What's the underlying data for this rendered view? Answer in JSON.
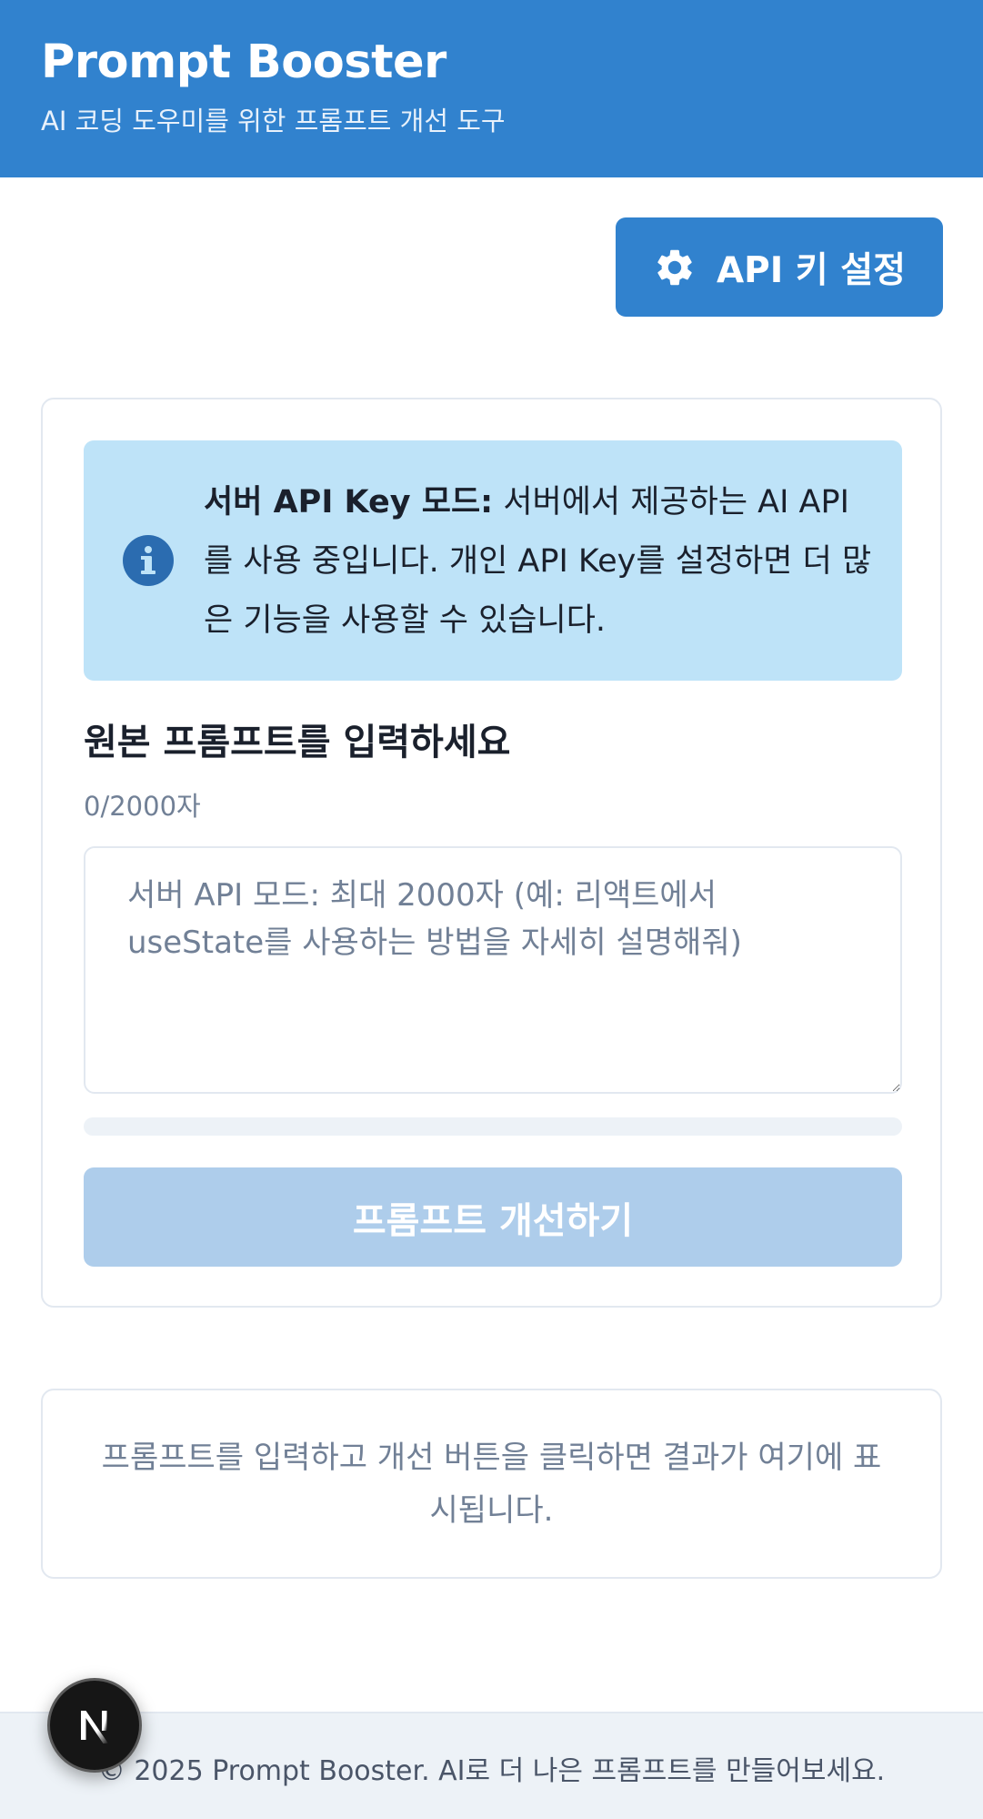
{
  "header": {
    "title": "Prompt Booster",
    "subtitle": "AI 코딩 도우미를 위한 프롬프트 개선 도구"
  },
  "toolbar": {
    "api_settings_label": "API 키 설정",
    "api_settings_icon": "gear-icon"
  },
  "info": {
    "icon": "info-icon",
    "bold_label": "서버 API Key 모드:",
    "message": " 서버에서 제공하는 AI API를 사용 중입니다. 개인 API Key를 설정하면 더 많은 기능을 사용할 수 있습니다."
  },
  "prompt": {
    "label": "원본 프롬프트를 입력하세요",
    "char_count": "0/2000자",
    "value": "",
    "placeholder": "서버 API 모드: 최대 2000자 (예: 리액트에서 useState를 사용하는 방법을 자세히 설명해줘)",
    "progress": 0
  },
  "submit": {
    "label": "프롬프트 개선하기"
  },
  "result": {
    "empty_message": "프롬프트를 입력하고 개선 버튼을 클릭하면 결과가 여기에 표시됩니다."
  },
  "footer": {
    "text": "© 2025 Prompt Booster. AI로 더 나은 프롬프트를 만들어보세요."
  },
  "dev_badge": {
    "label": "N",
    "icon": "nextjs-logo-icon"
  },
  "colors": {
    "primary": "#3182ce",
    "info_bg": "#bee3f8",
    "info_icon": "#2b6cb0",
    "disabled_button": "#aecdeb",
    "muted_text": "#718096",
    "footer_bg": "#edf2f7"
  }
}
